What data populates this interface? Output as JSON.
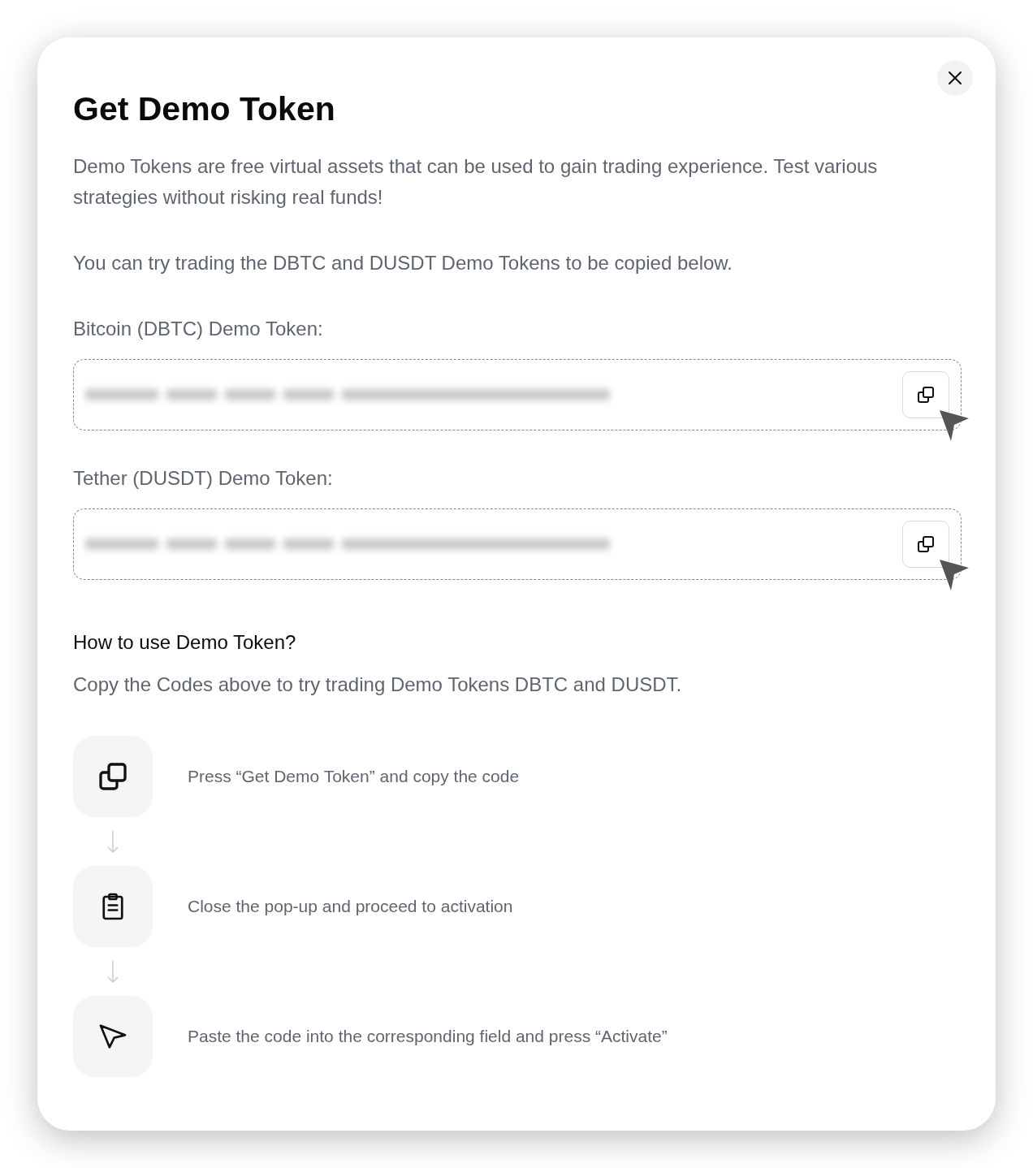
{
  "dialog": {
    "title": "Get Demo Token",
    "intro": "Demo Tokens are free virtual assets that can be used to gain trading experience. Test various strategies without risking real funds!",
    "note": "You can try trading the DBTC and DUSDT Demo Tokens to be copied below."
  },
  "tokens": [
    {
      "label": "Bitcoin (DBTC) Demo Token:"
    },
    {
      "label": "Tether (DUSDT) Demo Token:"
    }
  ],
  "how_to": {
    "heading": "How to use Demo Token?",
    "text": "Copy the Codes above to try trading Demo Tokens DBTC and DUSDT.",
    "steps": [
      {
        "kind": "copy",
        "text": "Press “Get Demo Token” and copy the code"
      },
      {
        "kind": "clipboard",
        "text": "Close the pop-up and proceed to activation"
      },
      {
        "kind": "cursor",
        "text": "Paste the code into the corresponding field and press “Activate”"
      }
    ]
  }
}
